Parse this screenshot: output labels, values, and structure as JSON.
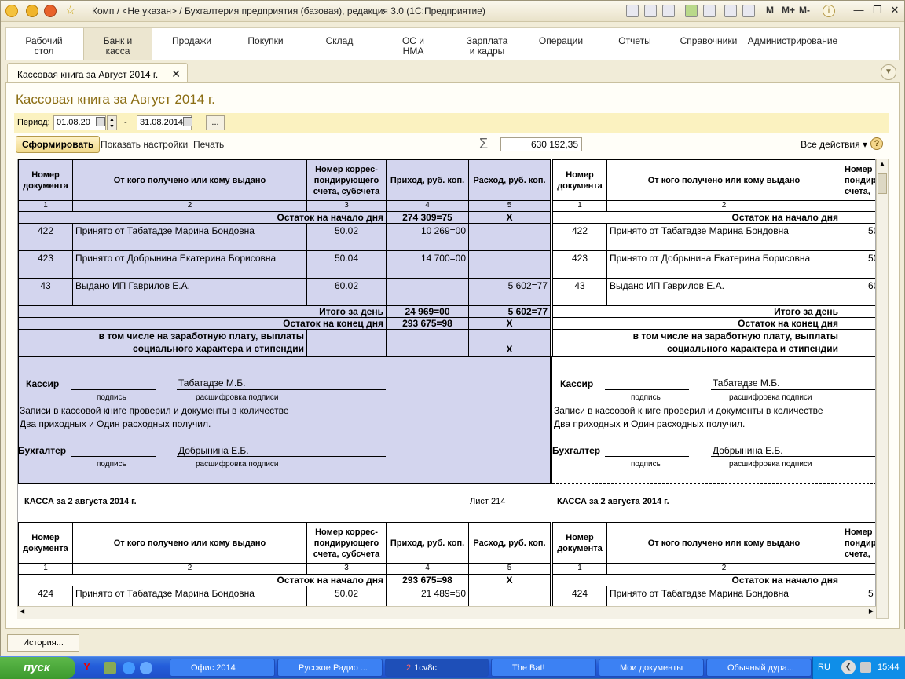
{
  "window": {
    "title": "Комп / <Не указан> / Бухгалтерия предприятия (базовая), редакция 3.0  (1С:Предприятие)",
    "m_labels": [
      "M",
      "M+",
      "M-"
    ]
  },
  "sections": [
    "Рабочий\nстол",
    "Банк и\nкасса",
    "Продажи",
    "Покупки",
    "Склад",
    "ОС и\nНМА",
    "Зарплата\nи кадры",
    "Операции",
    "Отчеты",
    "Справочники",
    "Администрирование"
  ],
  "doc_tab": {
    "label": "Кассовая книга за Август 2014 г.",
    "close": "✕"
  },
  "form": {
    "title": "Кассовая книга за Август 2014 г.",
    "period_label": "Период:",
    "date_from": "01.08.20",
    "dash": "-",
    "date_to": "31.08.2014",
    "dots": "...",
    "btn_generate": "Сформировать",
    "link_settings": "Показать настройки",
    "link_print": "Печать",
    "sum": "630 192,35",
    "all_actions": "Все действия ▾",
    "help": "?"
  },
  "table": {
    "h_num": "Номер документа",
    "h_from": "От кого получено или кому выдано",
    "h_corr": "Номер коррес-пондирующего счета, субсчета",
    "h_in": "Приход, руб. коп.",
    "h_out": "Расход, руб. коп.",
    "col_nums": [
      "1",
      "2",
      "3",
      "4",
      "5"
    ],
    "open_label": "Остаток на начало дня",
    "open_in": "274 309=75",
    "x": "X",
    "rows": [
      {
        "num": "422",
        "text": "Принято от Табатадзе Марина  Бондовна",
        "corr": "50.02",
        "in": "10 269=00",
        "out": ""
      },
      {
        "num": "423",
        "text": "Принято от Добрынина Екатерина Борисовна",
        "corr": "50.04",
        "in": "14 700=00",
        "out": ""
      },
      {
        "num": "43",
        "text": "Выдано ИП Гаврилов Е.А.",
        "corr": "60.02",
        "in": "",
        "out": "5 602=77"
      }
    ],
    "total_label": "Итого за день",
    "total_in": "24 969=00",
    "total_out": "5 602=77",
    "close_label": "Остаток на конец  дня",
    "close_in": "293 675=98",
    "salary_label1": "в том числе на заработную плату, выплаты",
    "salary_label2": "социального характера и стипендии",
    "cashier": "Кассир",
    "cashier_name": "Табатадзе М.Б.",
    "sign": "подпись",
    "sign_decode": "расшифровка подписи",
    "check1": "Записи в кассовой книге проверил и документы в количестве",
    "check2": "Два приходных и Один расходных получил.",
    "accountant": "Бухгалтер",
    "accountant_name": "Добрынина Е.Б.",
    "kassa_title": "КАССА за 2 августа 2014 г.",
    "sheet": "Лист 214",
    "p2_open_in": "293 675=98",
    "p2_row": {
      "num": "424",
      "text": "Принято от Табатадзе Марина  Бондовна",
      "corr": "50.02",
      "in": "21 489=50"
    },
    "right_trunc_h": "Номер пондиру счета,",
    "right_trunc_v1": "50",
    "right_trunc_v3": "60",
    "right_trunc_p2": "5"
  },
  "bottom": {
    "history": "История..."
  },
  "taskbar": {
    "start": "пуск",
    "items": [
      "Офис 2014",
      "Русское Радио ...",
      "1cv8c",
      "The Bat!",
      "Мои документы",
      "Обычный дура..."
    ],
    "badge": "2",
    "lang": "RU",
    "clock": "15:44"
  }
}
